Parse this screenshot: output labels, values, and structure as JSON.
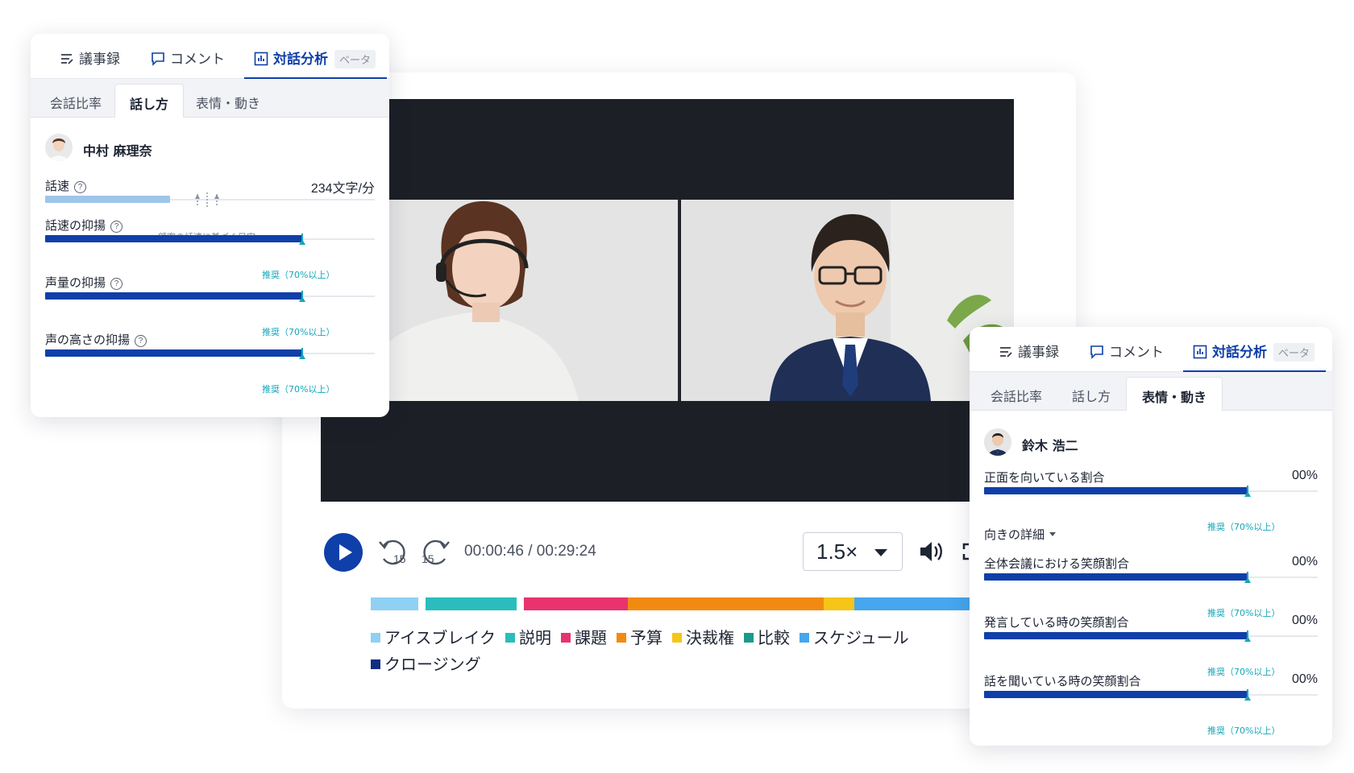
{
  "video": {
    "time_display": "00:00:46 / 00:29:24",
    "speed": "1.5×",
    "skip_back_seconds": "15",
    "skip_forward_seconds": "15",
    "topics": [
      {
        "label": "アイスブレイク",
        "color": "#8fd0f4",
        "share": 0.09
      },
      {
        "label": "説明",
        "color": "#2bbdbd",
        "share": 0.16
      },
      {
        "label": "課題",
        "color": "#e8336e",
        "share": 0.17
      },
      {
        "label": "予算",
        "color": "#f28a12",
        "share": 0.32
      },
      {
        "label": "決裁権",
        "color": "#f5c518",
        "share": 0.05
      },
      {
        "label": "比較",
        "color": "#1a9a8c",
        "share": 0
      },
      {
        "label": "スケジュール",
        "color": "#46a6ee",
        "share": 0.21
      },
      {
        "label": "クロージング",
        "color": "#0f2e84",
        "share": 0
      }
    ]
  },
  "left_panel": {
    "tabs": {
      "minutes": "議事録",
      "comment": "コメント",
      "analysis": "対話分析",
      "beta": "ベータ"
    },
    "sub_tabs": {
      "ratio": "会話比率",
      "speaking": "話し方",
      "expression": "表情・動き"
    },
    "person": "中村 麻理奈",
    "speed": {
      "label": "話速",
      "value": "234文字/分",
      "level": 0.38,
      "guide_note": "顧客の話速に基づく目安"
    },
    "metrics": [
      {
        "label": "話速の抑揚",
        "level": 0.78,
        "note": "推奨（70%以上）"
      },
      {
        "label": "声量の抑揚",
        "level": 0.78,
        "note": "推奨（70%以上）"
      },
      {
        "label": "声の高さの抑揚",
        "level": 0.78,
        "note": "推奨（70%以上）"
      }
    ]
  },
  "right_panel": {
    "tabs": {
      "minutes": "議事録",
      "comment": "コメント",
      "analysis": "対話分析",
      "beta": "ベータ"
    },
    "sub_tabs": {
      "ratio": "会話比率",
      "speaking": "話し方",
      "expression": "表情・動き"
    },
    "person": "鈴木 浩二",
    "direction_detail": "向きの詳細",
    "metrics": [
      {
        "label": "正面を向いている割合",
        "value": "00%",
        "level": 0.79,
        "note": "推奨（70%以上）"
      },
      {
        "label": "全体会議における笑顔割合",
        "value": "00%",
        "level": 0.79,
        "note": "推奨（70%以上）"
      },
      {
        "label": "発言している時の笑顔割合",
        "value": "00%",
        "level": 0.79,
        "note": "推奨（70%以上）"
      },
      {
        "label": "話を聞いている時の笑顔割合",
        "value": "00%",
        "level": 0.79,
        "note": "推奨（70%以上）"
      }
    ]
  }
}
